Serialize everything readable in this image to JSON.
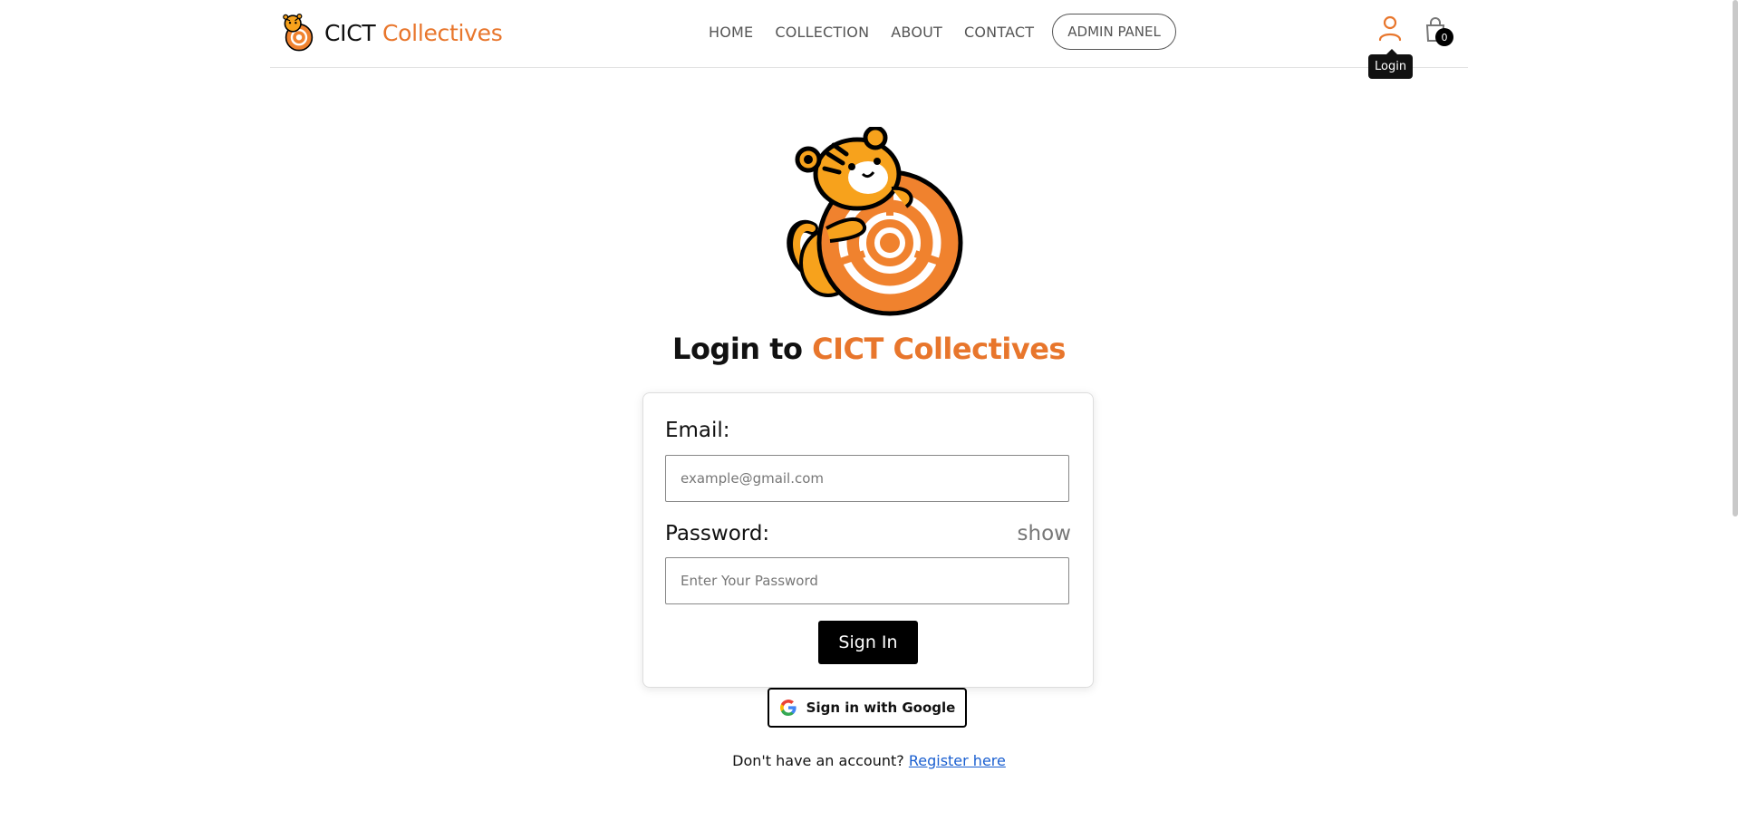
{
  "brand": {
    "name_part1": "CICT",
    "name_part2": "Collectives"
  },
  "nav": {
    "home": "HOME",
    "collection": "COLLECTION",
    "about": "ABOUT",
    "contact": "CONTACT",
    "admin": "ADMIN PANEL"
  },
  "header": {
    "cart_count": "0",
    "tooltip": "Login"
  },
  "login": {
    "title_part1": "Login to",
    "title_part2": "CICT Collectives",
    "email_label": "Email:",
    "email_placeholder": "example@gmail.com",
    "password_label": "Password:",
    "show_label": "show",
    "password_placeholder": "Enter Your Password",
    "signin_label": "Sign In",
    "google_label": "Sign in with Google",
    "register_prompt": "Don't have an account?",
    "register_link": "Register here"
  },
  "colors": {
    "accent": "#e8762c",
    "link": "#1a5fd0"
  },
  "icons": {
    "user": "user-icon",
    "cart": "shopping-bag-icon",
    "google": "google-icon",
    "logo": "tiger-logo-icon"
  }
}
